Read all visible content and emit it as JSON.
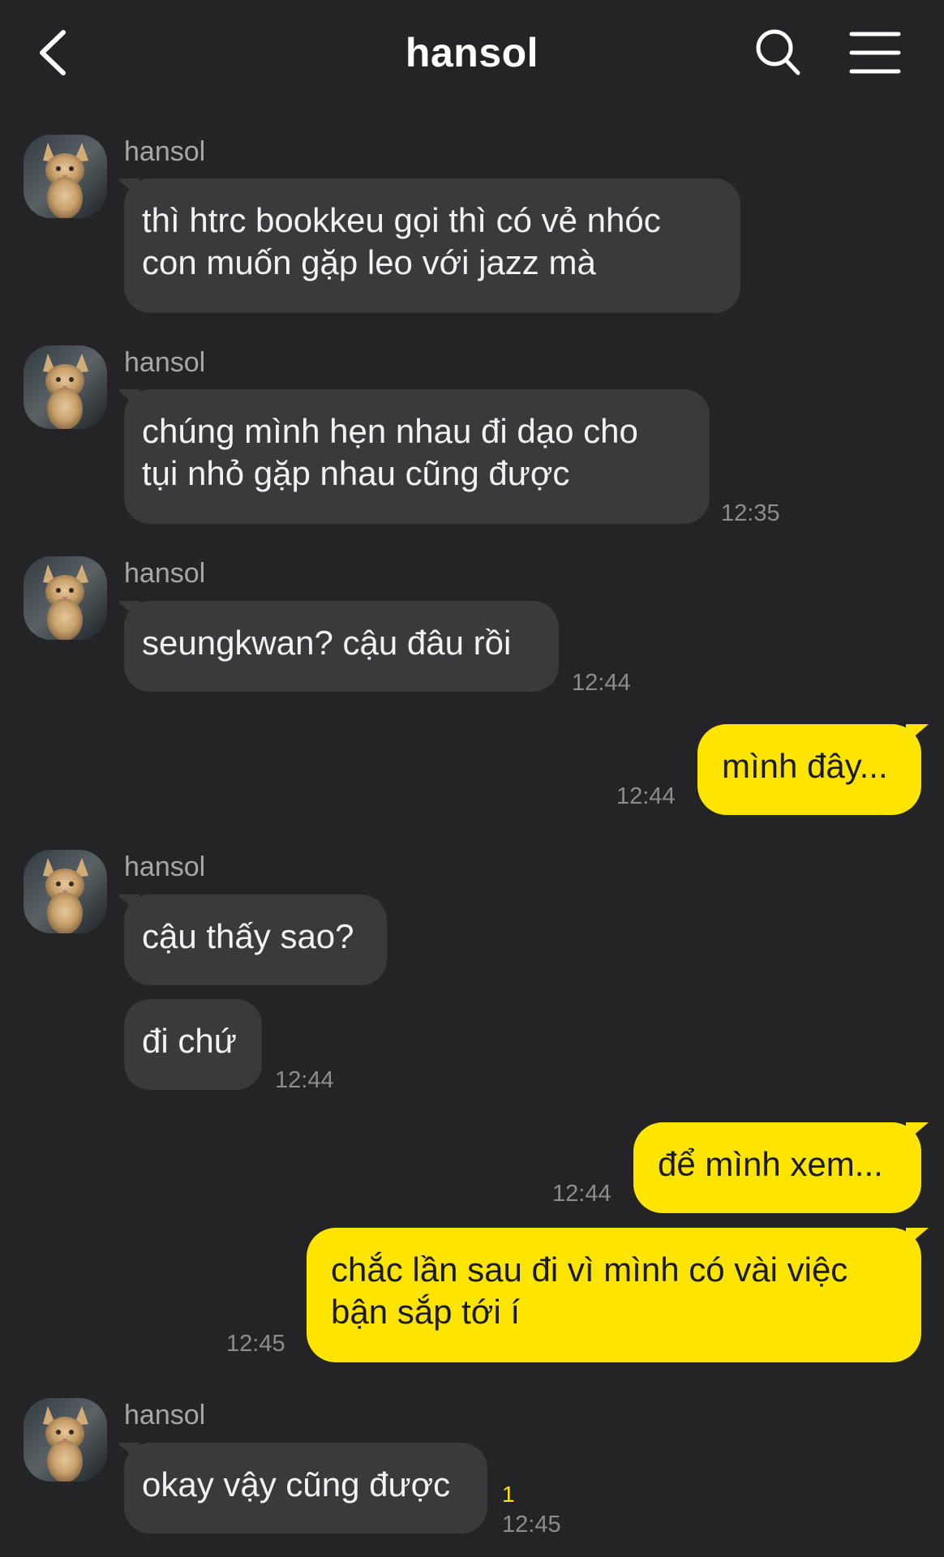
{
  "header": {
    "title": "hansol"
  },
  "sender_name": "hansol",
  "messages": [
    {
      "line1": "thì htrc bookkeu gọi thì có vẻ nhóc",
      "line2": "con muốn gặp leo với jazz mà"
    },
    {
      "line1": "chúng mình hẹn nhau đi dạo cho",
      "line2": "tụi nhỏ gặp nhau cũng được",
      "time": "12:35"
    },
    {
      "text": "seungkwan? cậu đâu rồi",
      "time": "12:44"
    },
    {
      "text": "mình đây...",
      "time": "12:44"
    },
    {
      "text": "cậu thấy sao?"
    },
    {
      "text": "đi chứ",
      "time": "12:44"
    },
    {
      "text": "để mình xem...",
      "time": "12:44"
    },
    {
      "line1": "chắc lần sau đi vì mình có vài việc",
      "line2": "bận sắp tới í",
      "time": "12:45"
    },
    {
      "text": "okay vậy cũng được",
      "time": "12:45",
      "unread": "1"
    }
  ],
  "colors": {
    "background": "#242427",
    "incoming_bubble": "#3a3a3d",
    "outgoing_bubble": "#fde500",
    "timestamp": "#8d8d90",
    "sender_name": "#a7a7aa"
  },
  "icons": {
    "back": "chevron-left-icon",
    "search": "search-icon",
    "menu": "hamburger-menu-icon",
    "avatar": "cat-avatar-image"
  }
}
